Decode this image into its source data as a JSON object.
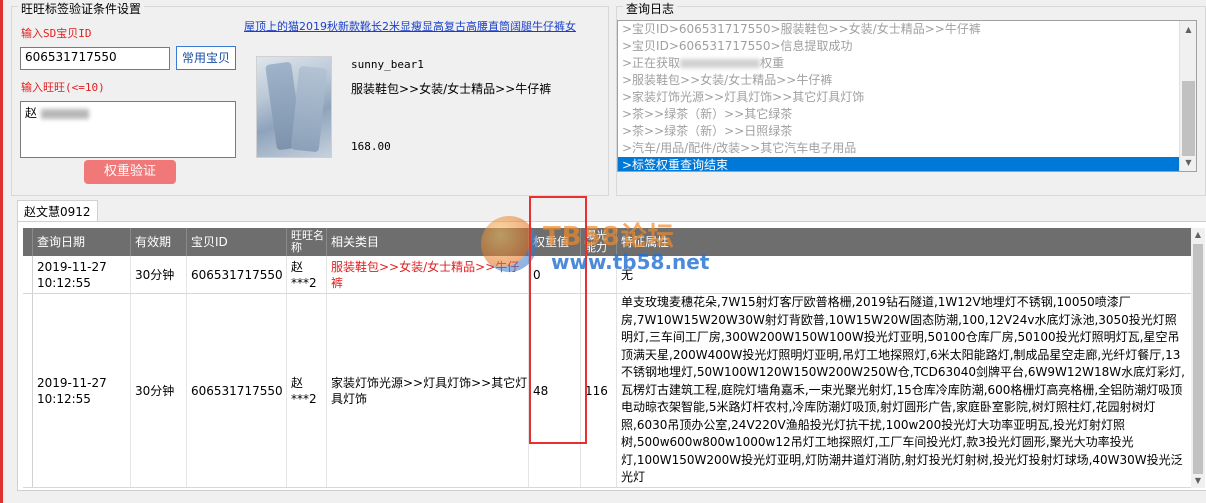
{
  "left_group": {
    "title": "旺旺标签验证条件设置",
    "sd_label": "输入SD宝贝ID",
    "sd_value": "606531717550",
    "common_button": "常用宝贝",
    "wangwang_label": "输入旺旺(<=10)",
    "wangwang_value": "赵 ",
    "verify_button": "权重验证",
    "product": {
      "title": "屋顶上的猫2019秋新款靴长2米显瘦显高复古高腰直筒阔腿牛仔裤女",
      "seller": "sunny_bear1",
      "category": "服装鞋包>>女装/女士精品>>牛仔裤",
      "price": "168.00"
    }
  },
  "log_group": {
    "title": "查询日志",
    "lines": [
      ">宝贝ID>606531717550>服装鞋包>>女装/女士精品>>牛仔裤",
      ">宝贝ID>606531717550>信息提取成功",
      ">正在获取",
      ">服装鞋包>>女装/女士精品>>牛仔裤",
      ">家装灯饰光源>>灯具灯饰>>其它灯具灯饰",
      ">茶>>绿茶（新）>>其它绿茶",
      ">茶>>绿茶（新）>>日照绿茶",
      ">汽车/用品/配件/改装>>其它汽车电子用品",
      ">标签权重查询结束"
    ],
    "log_line_suffix": "权重",
    "selected_index": 8
  },
  "tab": {
    "label": "赵文慧0912"
  },
  "grid": {
    "columns": [
      "查询日期",
      "有效期",
      "宝贝ID",
      "旺旺名称",
      "相关类目",
      "权重值",
      "曝光能力",
      "特征属性"
    ],
    "rows": [
      {
        "date": "2019-11-27 10:12:55",
        "validity": "30分钟",
        "item_id": "606531717550",
        "wangwang": "赵 ***2",
        "category": "服装鞋包>>女装/女士精品>>牛仔裤",
        "category_red": true,
        "weight": "0",
        "exposure": "",
        "features": "无"
      },
      {
        "date": "2019-11-27 10:12:55",
        "validity": "30分钟",
        "item_id": "606531717550",
        "wangwang": "赵 ***2",
        "category": "家装灯饰光源>>灯具灯饰>>其它灯具灯饰",
        "category_red": false,
        "weight": "48",
        "exposure": "116",
        "features": "单支玫瑰麦穗花朵,7W15射灯客厅欧普格栅,2019钻石隧道,1W12V地埋灯不锈钢,10050喷漆厂房,7W10W15W20W30W射灯背欧普,10W15W20W固态防潮,100,12V24v水底灯泳池,3050投光灯照明灯,三车间工厂房,300W200W150W100W投光灯亚明,50100仓库厂房,50100投光灯照明灯瓦,星空吊顶满天星,200W400W投光灯照明灯亚明,吊灯工地探照灯,6米太阳能路灯,制成品星空走廊,光纤灯餐厅,13不锈钢地埋灯,50W100W120W150W200W250W仓,TCD63040剑牌平台,6W9W12W18W水底灯彩灯,瓦楞灯古建筑工程,庭院灯墙角嘉禾,一束光聚光射灯,15仓库冷库防潮,600格栅灯高亮格栅,全铝防潮灯吸顶电动晾衣架智能,5米路灯杆农村,冷库防潮灯吸顶,射灯圆形广告,家庭卧室影院,树灯照柱灯,花园射树灯照,6030吊顶办公室,24V220V渔船投光灯抗干扰,100w200投光灯大功率亚明瓦,投光灯射灯照树,500w600w800w1000w12吊灯工地探照灯,工厂车间投光灯,款3投光灯圆形,聚光大功率投光灯,100W150W200W投光灯亚明,灯防潮井道灯消防,射灯投光灯射树,投光灯投射灯球场,40W30W投光泛光灯"
      }
    ]
  },
  "watermark": {
    "title": "TB58论坛",
    "url": "www.tb58.net"
  },
  "colors": {
    "accent_red": "#e02020",
    "selection_blue": "#0078d7",
    "header_gray": "#6e6e6e"
  }
}
